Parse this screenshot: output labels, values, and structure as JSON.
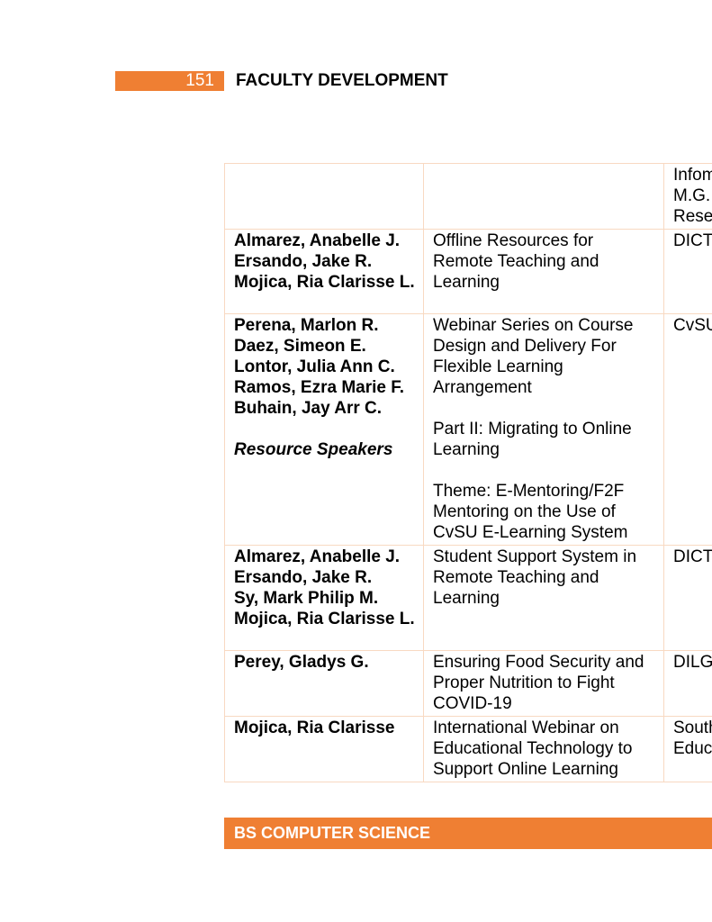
{
  "header": {
    "page_number": "151",
    "section_title": "FACULTY DEVELOPMENT"
  },
  "rows": [
    {
      "names": [],
      "role": "",
      "title": [],
      "org": [
        "Infom",
        "M.G.",
        "Rese"
      ]
    },
    {
      "names": [
        "Almarez, Anabelle J.",
        "Ersando, Jake R.",
        "Mojica, Ria Clarisse L."
      ],
      "role": "",
      "title": [
        "Offline Resources for Remote Teaching and Learning"
      ],
      "org": [
        "DICT"
      ]
    },
    {
      "names": [
        "Perena, Marlon R.",
        "Daez, Simeon E.",
        "Lontor, Julia Ann C.",
        "Ramos, Ezra Marie F.",
        "Buhain, Jay Arr C."
      ],
      "role": "Resource Speakers",
      "title": [
        "Webinar Series on Course Design and Delivery For Flexible Learning Arrangement",
        "Part II: Migrating to Online Learning",
        "Theme: E-Mentoring/F2F Mentoring on the Use of CvSU E-Learning System"
      ],
      "org": [
        "CvSU"
      ]
    },
    {
      "names": [
        "Almarez, Anabelle J.",
        "Ersando, Jake R.",
        "Sy, Mark Philip M.",
        "Mojica, Ria Clarisse L."
      ],
      "role": "",
      "title": [
        "Student Support System in Remote Teaching and Learning"
      ],
      "org": [
        "DICT"
      ]
    },
    {
      "names": [
        "Perey, Gladys G."
      ],
      "role": "",
      "title": [
        "Ensuring Food Security and Proper Nutrition to Fight COVID-19"
      ],
      "org": [
        "DILG"
      ]
    },
    {
      "names": [
        "Mojica, Ria Clarisse"
      ],
      "role": "",
      "title": [
        "International Webinar on Educational Technology to Support Online Learning"
      ],
      "org": [
        "South",
        "Educ"
      ]
    }
  ],
  "footer": {
    "program": "BS COMPUTER SCIENCE"
  },
  "colors": {
    "accent": "#ef7f33",
    "table_border": "#f8d9c2"
  }
}
